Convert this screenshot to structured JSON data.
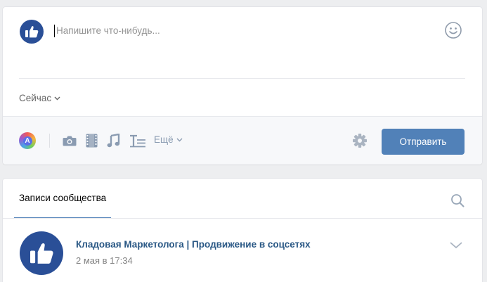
{
  "composer": {
    "placeholder": "Напишите что-нибудь...",
    "time_label": "Сейчас",
    "more_label": "Ещё",
    "send_label": "Отправить",
    "icons": [
      "like-avatar-icon",
      "smiley-icon",
      "chevron-down-icon",
      "color-palette-icon",
      "camera-icon",
      "video-icon",
      "music-icon",
      "text-format-icon",
      "gear-icon"
    ]
  },
  "feed": {
    "tab_label": "Записи сообщества",
    "post": {
      "author": "Кладовая Маркетолога | Продвижение в соцсетях",
      "date": "2 мая в 17:34"
    }
  },
  "colors": {
    "accent": "#5181b8",
    "link": "#2a5885",
    "avatar": "#2a4f97",
    "background": "#edeef0",
    "muted_icon": "#8a9bb1"
  }
}
